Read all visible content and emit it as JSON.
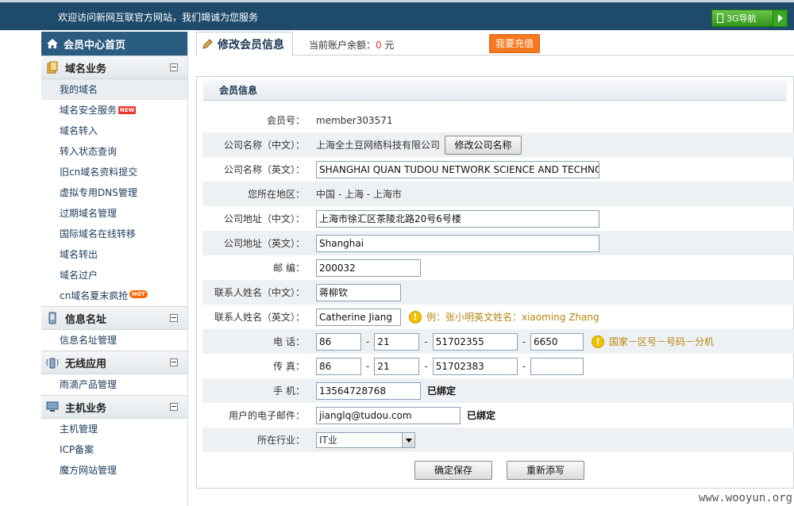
{
  "topbar": {
    "welcome": "欢迎访问新网互联官方网站，我们竭诚为您服务",
    "nav3g_label": "3G导航"
  },
  "sidebar": {
    "home_label": "会员中心首页",
    "sections": [
      {
        "title": "域名业务",
        "items": [
          "我的域名",
          "域名安全服务",
          "域名转入",
          "转入状态查询",
          "旧cn域名资料提交",
          "虚拟专用DNS管理",
          "过期域名管理",
          "国际域名在线转移",
          "域名转出",
          "域名过户",
          "cn域名夏末疯抢"
        ]
      },
      {
        "title": "信息名址",
        "items": [
          "信息名址管理"
        ]
      },
      {
        "title": "无线应用",
        "items": [
          "雨滴产品管理"
        ]
      },
      {
        "title": "主机业务",
        "items": [
          "主机管理",
          "ICP备案",
          "魔方网站管理"
        ]
      }
    ],
    "badges": {
      "new": "NEW",
      "hot": "HOT"
    }
  },
  "main": {
    "tab_title": "修改会员信息",
    "balance_label": "当前账户余额：",
    "balance_amount": "0",
    "balance_unit": "元",
    "recharge_label": "我要充值",
    "panel_title": "会员信息"
  },
  "form": {
    "member_id_label": "会员号：",
    "member_id": "member303571",
    "company_cn_label": "公司名称（中文）：",
    "company_cn": "上海全土豆网络科技有限公司",
    "modify_company_button": "修改公司名称",
    "company_en_label": "公司名称（英文）：",
    "company_en": "SHANGHAI QUAN TUDOU NETWORK SCIENCE AND TECHNOL",
    "region_label": "您所在地区：",
    "region": "中国 - 上海 - 上海市",
    "address_cn_label": "公司地址（中文）：",
    "address_cn": "上海市徐汇区茶陵北路20号6号楼",
    "address_en_label": "公司地址（英文）：",
    "address_en": "Shanghai",
    "postcode_label": "邮    编：",
    "postcode": "200032",
    "contact_cn_label": "联系人姓名（中文）：",
    "contact_cn": "蒋柳钦",
    "contact_en_label": "联系人姓名（英文）：",
    "contact_en": "Catherine Jiang",
    "contact_en_hint": "例：张小明英文姓名：xiaoming Zhang",
    "phone_label": "电    话：",
    "phone_country": "86",
    "phone_area": "21",
    "phone_number": "51702355",
    "phone_ext": "6650",
    "phone_hint": "国家－区号－号码－分机",
    "fax_label": "传    真：",
    "fax_country": "86",
    "fax_area": "21",
    "fax_number": "51702383",
    "fax_ext": "",
    "mobile_label": "手 机：",
    "mobile": "13564728768",
    "mobile_status": "已绑定",
    "email_label": "用户的电子邮件：",
    "email": "jianglq@tudou.com",
    "email_status": "已绑定",
    "industry_label": "所在行业：",
    "industry": "IT业",
    "save_button": "确定保存",
    "reset_button": "重新添写"
  },
  "watermark": "www.wooyun.org",
  "colors": {
    "topbar": "#1e4b6b",
    "recharge": "#f7791f",
    "row_alt": "#eef1f4"
  }
}
